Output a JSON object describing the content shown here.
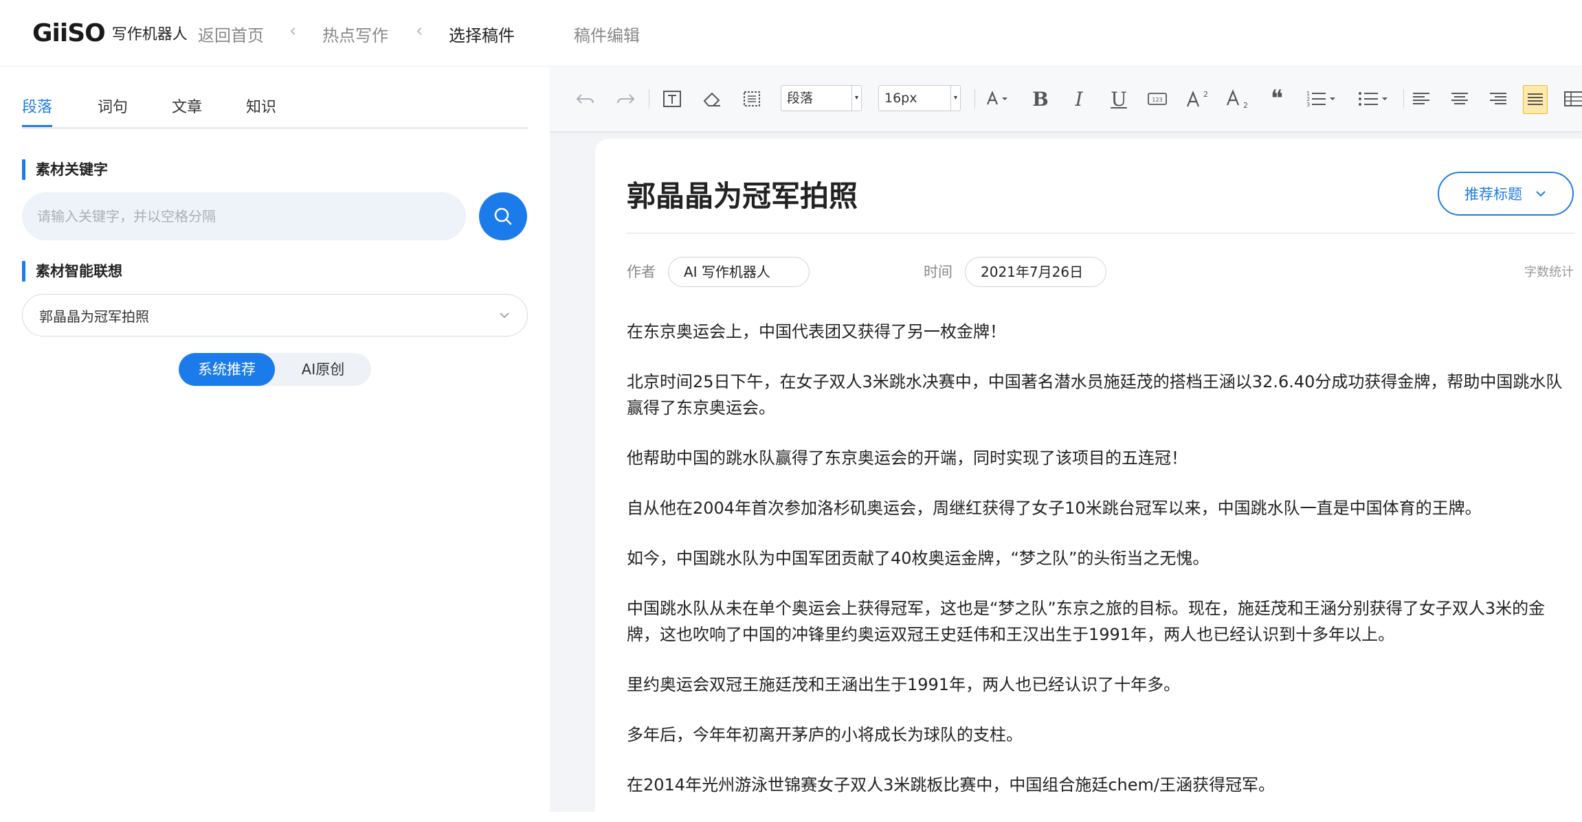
{
  "header": {
    "logo_mark": "GiiSO",
    "logo_text": "写作机器人",
    "breadcrumbs": [
      "返回首页",
      "热点写作",
      "选择稿件"
    ],
    "edit_label": "稿件编辑"
  },
  "left": {
    "tabs": [
      "段落",
      "词句",
      "文章",
      "知识"
    ],
    "keyword_section": "素材关键字",
    "keyword_placeholder": "请输入关键字，并以空格分隔",
    "suggest_section": "素材智能联想",
    "suggest_value": "郭晶晶为冠军拍照",
    "modes": [
      "系统推荐",
      "AI原创"
    ]
  },
  "toolbar": {
    "paragraph_select": "段落",
    "size_select": "16px",
    "bold": "B",
    "italic": "I",
    "underline": "U",
    "quote": "❝"
  },
  "doc": {
    "title": "郭晶晶为冠军拍照",
    "recommend_label": "推荐标题",
    "author_label": "作者",
    "author_value": "AI 写作机器人",
    "time_label": "时间",
    "time_value": "2021年7月26日",
    "word_count_label": "字数统计",
    "paragraphs": [
      "在东京奥运会上，中国代表团又获得了另一枚金牌！",
      "北京时间25日下午，在女子双人3米跳水决赛中，中国著名潜水员施廷茂的搭档王涵以32.6.40分成功获得金牌，帮助中国跳水队赢得了东京奥运会。",
      "他帮助中国的跳水队赢得了东京奥运会的开端，同时实现了该项目的五连冠！",
      "自从他在2004年首次参加洛杉矶奥运会，周继红获得了女子10米跳台冠军以来，中国跳水队一直是中国体育的王牌。",
      "如今，中国跳水队为中国军团贡献了40枚奥运金牌，“梦之队”的头衔当之无愧。",
      "中国跳水队从未在单个奥运会上获得冠军，这也是“梦之队”东京之旅的目标。现在，施廷茂和王涵分别获得了女子双人3米的金牌，这也吹响了中国的冲锋里约奥运双冠王史廷伟和王汉出生于1991年，两人也已经认识到十多年以上。",
      "里约奥运会双冠王施廷茂和王涵出生于1991年，两人也已经认识了十年多。",
      "多年后，今年年初离开茅庐的小将成长为球队的支柱。",
      "在2014年光州游泳世锦赛女子双人3米跳板比赛中，中国组合施廷chem/王涵获得冠军。"
    ]
  },
  "colors": {
    "accent": "#1c7bea",
    "panel_bg": "#f2f4f7"
  }
}
